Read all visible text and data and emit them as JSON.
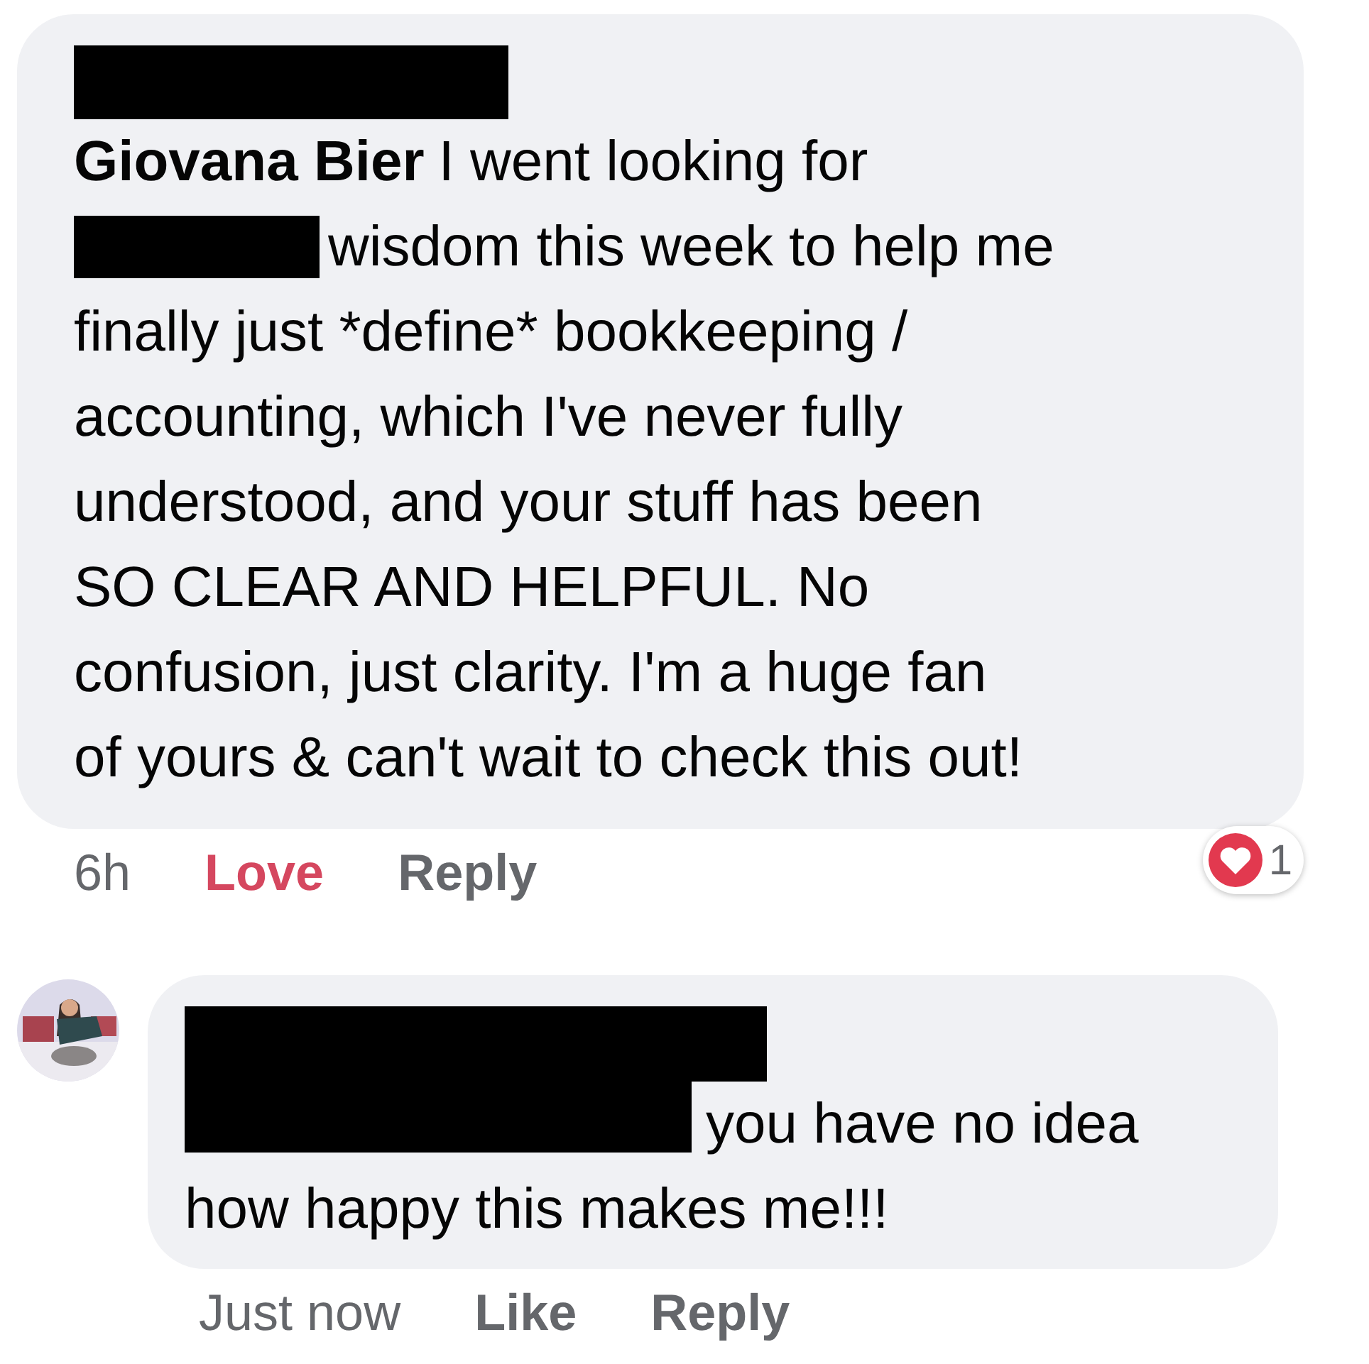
{
  "comment": {
    "author": "Giovana Bier",
    "intro": "I went looking for",
    "text": [
      "wisdom this week to help me",
      "finally just *define* bookkeeping /\naccounting, which I've never fully\nunderstood, and your stuff has been\nSO CLEAR AND HELPFUL. No\nconfusion, just clarity. I'm a huge fan\nof yours & can't wait to check this out!"
    ],
    "time": "6h",
    "actions": [
      {
        "label": "Love",
        "selected": true
      },
      {
        "label": "Reply",
        "selected": false
      }
    ],
    "reaction_count": "1"
  },
  "reply": {
    "text": [
      "you have no idea",
      "how happy this makes me!!!"
    ],
    "time": "Just now",
    "actions": [
      {
        "label": "Like",
        "selected": false
      },
      {
        "label": "Reply",
        "selected": false
      }
    ]
  }
}
